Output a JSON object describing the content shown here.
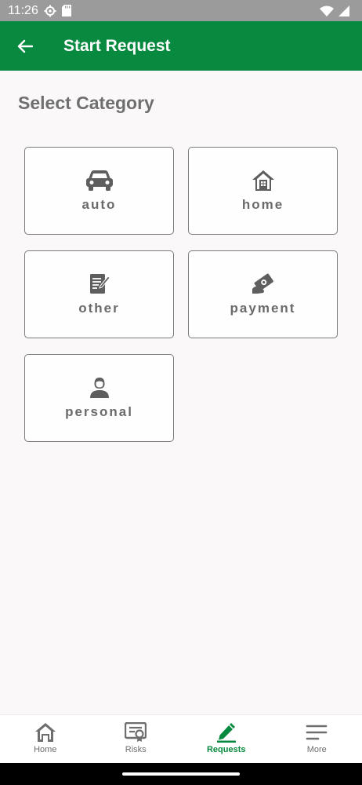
{
  "status_bar": {
    "time": "11:26"
  },
  "app_bar": {
    "title": "Start Request"
  },
  "section": {
    "title": "Select Category"
  },
  "categories": [
    {
      "label": "auto",
      "icon": "car-icon"
    },
    {
      "label": "home",
      "icon": "house-icon"
    },
    {
      "label": "other",
      "icon": "document-edit-icon"
    },
    {
      "label": "payment",
      "icon": "money-hand-icon"
    },
    {
      "label": "personal",
      "icon": "person-icon"
    }
  ],
  "bottom_nav": {
    "items": [
      {
        "label": "Home",
        "icon": "home-icon"
      },
      {
        "label": "Risks",
        "icon": "certificate-icon"
      },
      {
        "label": "Requests",
        "icon": "pencil-icon",
        "active": true
      },
      {
        "label": "More",
        "icon": "menu-lines-icon"
      }
    ]
  },
  "colors": {
    "primary": "#078a3f",
    "status_bar": "#9b9b9b",
    "background": "#faf8f9",
    "text_muted": "#6a6a6a"
  }
}
